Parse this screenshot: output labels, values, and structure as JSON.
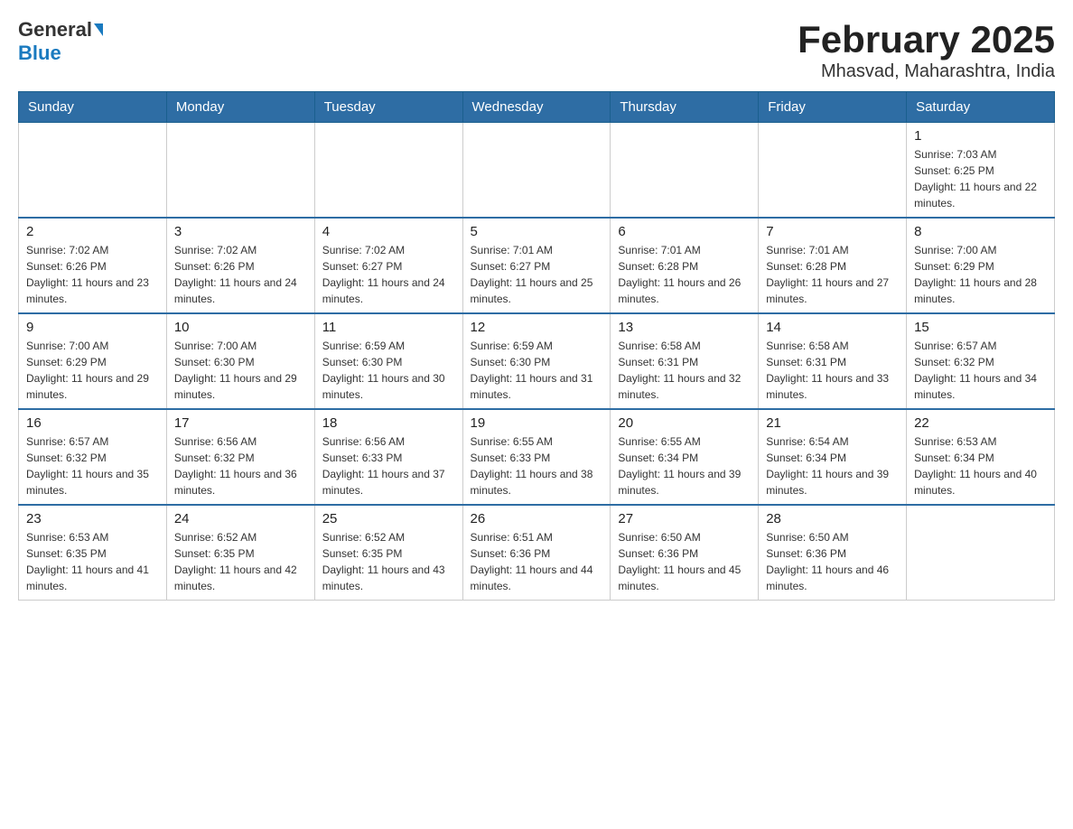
{
  "header": {
    "logo_general": "General",
    "logo_blue": "Blue",
    "title": "February 2025",
    "location": "Mhasvad, Maharashtra, India"
  },
  "calendar": {
    "days_of_week": [
      "Sunday",
      "Monday",
      "Tuesday",
      "Wednesday",
      "Thursday",
      "Friday",
      "Saturday"
    ],
    "weeks": [
      [
        {
          "day": "",
          "info": ""
        },
        {
          "day": "",
          "info": ""
        },
        {
          "day": "",
          "info": ""
        },
        {
          "day": "",
          "info": ""
        },
        {
          "day": "",
          "info": ""
        },
        {
          "day": "",
          "info": ""
        },
        {
          "day": "1",
          "info": "Sunrise: 7:03 AM\nSunset: 6:25 PM\nDaylight: 11 hours and 22 minutes."
        }
      ],
      [
        {
          "day": "2",
          "info": "Sunrise: 7:02 AM\nSunset: 6:26 PM\nDaylight: 11 hours and 23 minutes."
        },
        {
          "day": "3",
          "info": "Sunrise: 7:02 AM\nSunset: 6:26 PM\nDaylight: 11 hours and 24 minutes."
        },
        {
          "day": "4",
          "info": "Sunrise: 7:02 AM\nSunset: 6:27 PM\nDaylight: 11 hours and 24 minutes."
        },
        {
          "day": "5",
          "info": "Sunrise: 7:01 AM\nSunset: 6:27 PM\nDaylight: 11 hours and 25 minutes."
        },
        {
          "day": "6",
          "info": "Sunrise: 7:01 AM\nSunset: 6:28 PM\nDaylight: 11 hours and 26 minutes."
        },
        {
          "day": "7",
          "info": "Sunrise: 7:01 AM\nSunset: 6:28 PM\nDaylight: 11 hours and 27 minutes."
        },
        {
          "day": "8",
          "info": "Sunrise: 7:00 AM\nSunset: 6:29 PM\nDaylight: 11 hours and 28 minutes."
        }
      ],
      [
        {
          "day": "9",
          "info": "Sunrise: 7:00 AM\nSunset: 6:29 PM\nDaylight: 11 hours and 29 minutes."
        },
        {
          "day": "10",
          "info": "Sunrise: 7:00 AM\nSunset: 6:30 PM\nDaylight: 11 hours and 29 minutes."
        },
        {
          "day": "11",
          "info": "Sunrise: 6:59 AM\nSunset: 6:30 PM\nDaylight: 11 hours and 30 minutes."
        },
        {
          "day": "12",
          "info": "Sunrise: 6:59 AM\nSunset: 6:30 PM\nDaylight: 11 hours and 31 minutes."
        },
        {
          "day": "13",
          "info": "Sunrise: 6:58 AM\nSunset: 6:31 PM\nDaylight: 11 hours and 32 minutes."
        },
        {
          "day": "14",
          "info": "Sunrise: 6:58 AM\nSunset: 6:31 PM\nDaylight: 11 hours and 33 minutes."
        },
        {
          "day": "15",
          "info": "Sunrise: 6:57 AM\nSunset: 6:32 PM\nDaylight: 11 hours and 34 minutes."
        }
      ],
      [
        {
          "day": "16",
          "info": "Sunrise: 6:57 AM\nSunset: 6:32 PM\nDaylight: 11 hours and 35 minutes."
        },
        {
          "day": "17",
          "info": "Sunrise: 6:56 AM\nSunset: 6:32 PM\nDaylight: 11 hours and 36 minutes."
        },
        {
          "day": "18",
          "info": "Sunrise: 6:56 AM\nSunset: 6:33 PM\nDaylight: 11 hours and 37 minutes."
        },
        {
          "day": "19",
          "info": "Sunrise: 6:55 AM\nSunset: 6:33 PM\nDaylight: 11 hours and 38 minutes."
        },
        {
          "day": "20",
          "info": "Sunrise: 6:55 AM\nSunset: 6:34 PM\nDaylight: 11 hours and 39 minutes."
        },
        {
          "day": "21",
          "info": "Sunrise: 6:54 AM\nSunset: 6:34 PM\nDaylight: 11 hours and 39 minutes."
        },
        {
          "day": "22",
          "info": "Sunrise: 6:53 AM\nSunset: 6:34 PM\nDaylight: 11 hours and 40 minutes."
        }
      ],
      [
        {
          "day": "23",
          "info": "Sunrise: 6:53 AM\nSunset: 6:35 PM\nDaylight: 11 hours and 41 minutes."
        },
        {
          "day": "24",
          "info": "Sunrise: 6:52 AM\nSunset: 6:35 PM\nDaylight: 11 hours and 42 minutes."
        },
        {
          "day": "25",
          "info": "Sunrise: 6:52 AM\nSunset: 6:35 PM\nDaylight: 11 hours and 43 minutes."
        },
        {
          "day": "26",
          "info": "Sunrise: 6:51 AM\nSunset: 6:36 PM\nDaylight: 11 hours and 44 minutes."
        },
        {
          "day": "27",
          "info": "Sunrise: 6:50 AM\nSunset: 6:36 PM\nDaylight: 11 hours and 45 minutes."
        },
        {
          "day": "28",
          "info": "Sunrise: 6:50 AM\nSunset: 6:36 PM\nDaylight: 11 hours and 46 minutes."
        },
        {
          "day": "",
          "info": ""
        }
      ]
    ]
  }
}
